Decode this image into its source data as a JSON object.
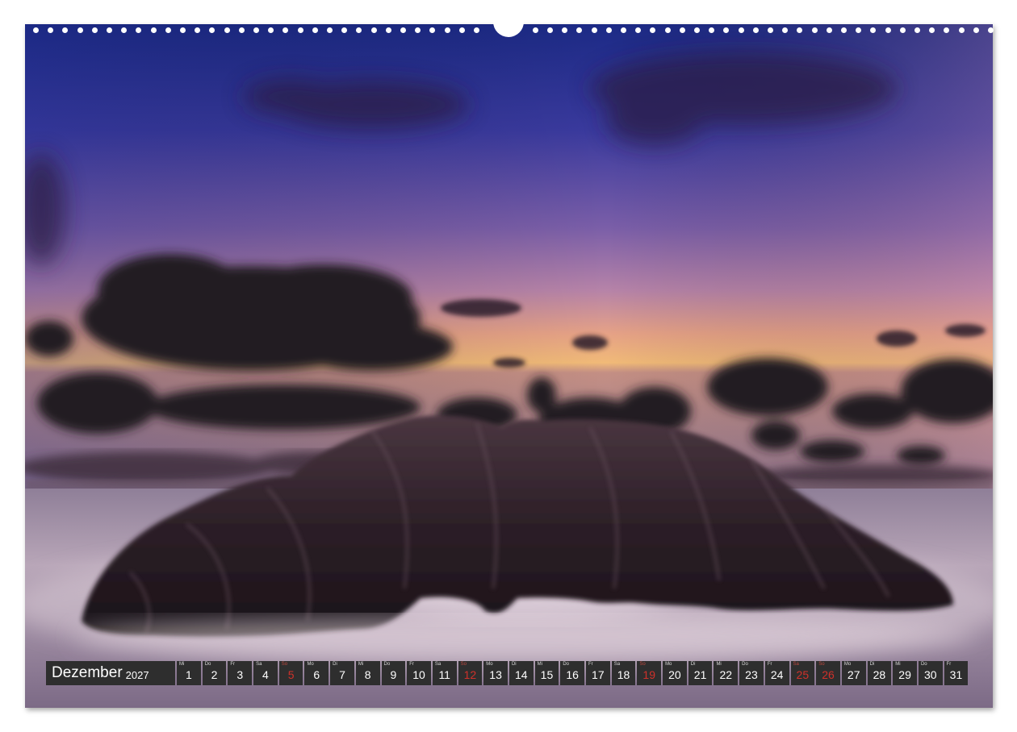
{
  "calendar": {
    "month": "Dezember",
    "year": "2027",
    "days": [
      {
        "num": "1",
        "wd": "Mi",
        "red": false
      },
      {
        "num": "2",
        "wd": "Do",
        "red": false
      },
      {
        "num": "3",
        "wd": "Fr",
        "red": false
      },
      {
        "num": "4",
        "wd": "Sa",
        "red": false
      },
      {
        "num": "5",
        "wd": "So",
        "red": true
      },
      {
        "num": "6",
        "wd": "Mo",
        "red": false
      },
      {
        "num": "7",
        "wd": "Di",
        "red": false
      },
      {
        "num": "8",
        "wd": "Mi",
        "red": false
      },
      {
        "num": "9",
        "wd": "Do",
        "red": false
      },
      {
        "num": "10",
        "wd": "Fr",
        "red": false
      },
      {
        "num": "11",
        "wd": "Sa",
        "red": false
      },
      {
        "num": "12",
        "wd": "So",
        "red": true
      },
      {
        "num": "13",
        "wd": "Mo",
        "red": false
      },
      {
        "num": "14",
        "wd": "Di",
        "red": false
      },
      {
        "num": "15",
        "wd": "Mi",
        "red": false
      },
      {
        "num": "16",
        "wd": "Do",
        "red": false
      },
      {
        "num": "17",
        "wd": "Fr",
        "red": false
      },
      {
        "num": "18",
        "wd": "Sa",
        "red": false
      },
      {
        "num": "19",
        "wd": "So",
        "red": true
      },
      {
        "num": "20",
        "wd": "Mo",
        "red": false
      },
      {
        "num": "21",
        "wd": "Di",
        "red": false
      },
      {
        "num": "22",
        "wd": "Mi",
        "red": false
      },
      {
        "num": "23",
        "wd": "Do",
        "red": false
      },
      {
        "num": "24",
        "wd": "Fr",
        "red": false
      },
      {
        "num": "25",
        "wd": "Sa",
        "red": true
      },
      {
        "num": "26",
        "wd": "So",
        "red": true
      },
      {
        "num": "27",
        "wd": "Mo",
        "red": false
      },
      {
        "num": "28",
        "wd": "Di",
        "red": false
      },
      {
        "num": "29",
        "wd": "Mi",
        "red": false
      },
      {
        "num": "30",
        "wd": "Do",
        "red": false
      },
      {
        "num": "31",
        "wd": "Fr",
        "red": false
      }
    ]
  },
  "colors": {
    "bar_background": "#2e2e2e",
    "weekend_red": "#d0312a",
    "sky_top": "#27338a",
    "sky_horizon": "#f0b070",
    "sea": "#c9b8c6",
    "rock": "#2a1e26"
  }
}
